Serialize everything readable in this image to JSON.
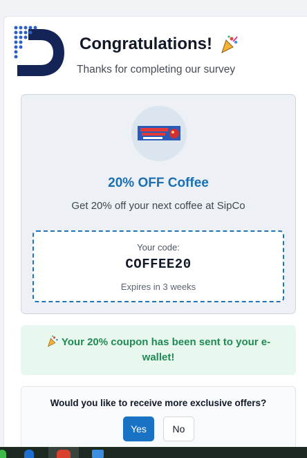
{
  "header": {
    "title": "Congratulations!",
    "title_icon": "party-popper-icon",
    "subtitle": "Thanks for completing our survey"
  },
  "logo": {
    "icon": "brand-d-logo",
    "color": "#142456"
  },
  "offer": {
    "image": "shop-local-banner",
    "title": "20% OFF Coffee",
    "description": "Get 20% off your next coffee at SipCo",
    "code_label": "Your code:",
    "code": "COFFEE20",
    "expiry": "Expires in 3 weeks",
    "accent": "#1a6fb3"
  },
  "notice": {
    "icon": "party-popper-icon",
    "text": "Your 20% coupon has been sent to your e-wallet!",
    "color": "#1f8a52"
  },
  "prompt": {
    "question": "Would you like to receive more exclusive offers?",
    "yes_label": "Yes",
    "no_label": "No"
  },
  "taskbar": {
    "icons": [
      "app-icon",
      "edge-icon",
      "chrome-icon",
      "photoshop-icon"
    ]
  }
}
